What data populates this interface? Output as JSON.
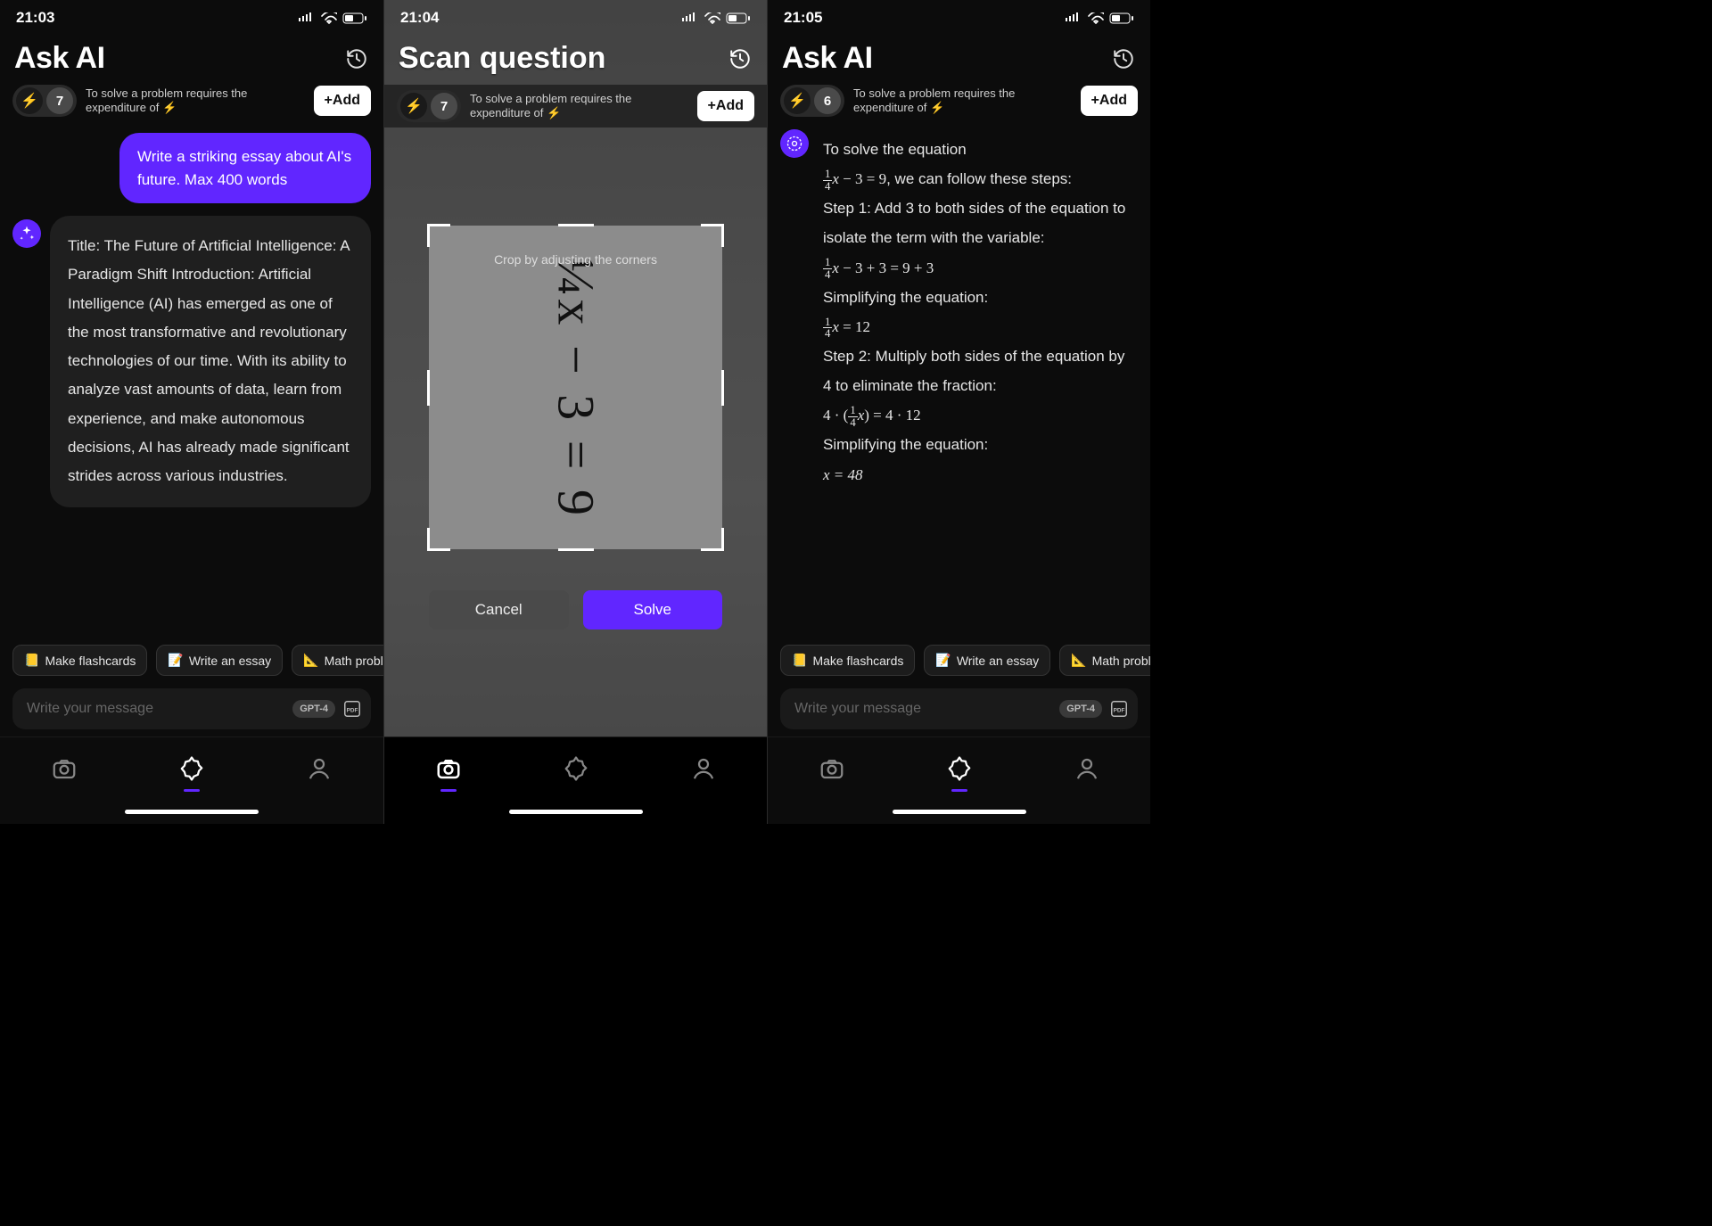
{
  "screens": [
    {
      "status": {
        "time": "21:03"
      },
      "header": {
        "title": "Ask AI"
      },
      "tokenBar": {
        "count": "7",
        "text": "To solve a problem requires the expenditure of ⚡",
        "addLabel": "+Add"
      },
      "userMessage": "Write a striking essay about AI's future. Max 400 words",
      "aiMessage": "Title: The Future of Artificial Intelligence: A Paradigm Shift\nIntroduction:\nArtificial Intelligence (AI) has emerged as one of the most transformative and revolutionary technologies of our time. With its ability to analyze vast amounts of data, learn from experience, and make autonomous decisions, AI has already made significant strides across various industries.",
      "chips": [
        "Make flashcards",
        "Write an essay",
        "Math probl"
      ],
      "input": {
        "placeholder": "Write your message",
        "model": "GPT-4"
      },
      "navActive": 1
    },
    {
      "status": {
        "time": "21:04"
      },
      "header": {
        "title": "Scan question"
      },
      "tokenBar": {
        "count": "7",
        "text": "To solve a problem requires the expenditure of ⚡",
        "addLabel": "+Add"
      },
      "crop": {
        "hint": "Crop by adjusting the corners",
        "equation": "¼x − 3 = 9"
      },
      "buttons": {
        "cancel": "Cancel",
        "solve": "Solve"
      },
      "navActive": 0
    },
    {
      "status": {
        "time": "21:05"
      },
      "header": {
        "title": "Ask AI"
      },
      "tokenBar": {
        "count": "6",
        "text": "To solve a problem requires the expenditure of ⚡",
        "addLabel": "+Add"
      },
      "aiMessage": {
        "intro": "To solve the equation",
        "eq1": ", we can follow these steps:",
        "s1": "Step 1: Add 3 to both sides of the equation to isolate the term with the variable:",
        "simp1": "Simplifying the equation:",
        "s2": "Step 2: Multiply both sides of the equation by 4 to eliminate the fraction:",
        "simp2": "Simplifying the equation:",
        "final": "x = 48"
      },
      "chips": [
        "Make flashcards",
        "Write an essay",
        "Math probl"
      ],
      "input": {
        "placeholder": "Write your message",
        "model": "GPT-4"
      },
      "navActive": 1
    }
  ],
  "icons": {
    "bolt": "⚡",
    "chip_flash": "📒",
    "chip_essay": "📝",
    "chip_math": "📐"
  }
}
